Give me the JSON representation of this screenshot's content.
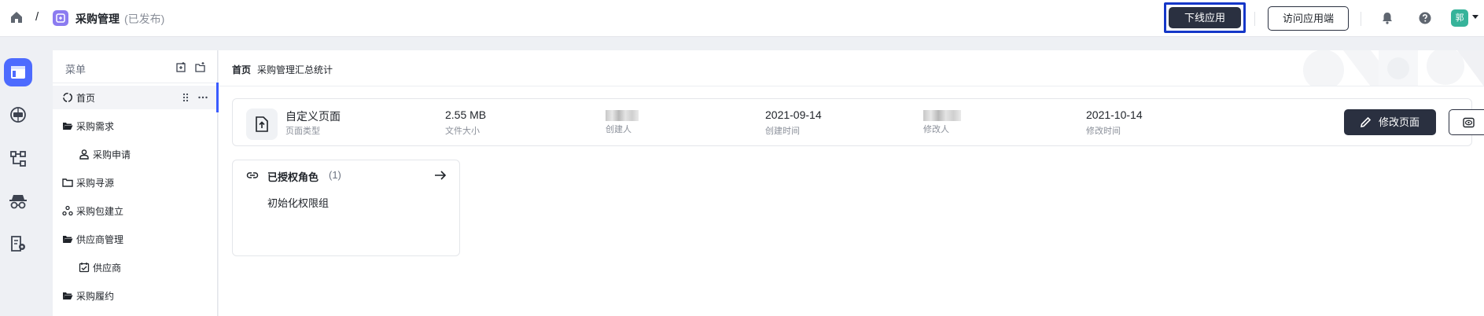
{
  "topbar": {
    "app_title": "采购管理",
    "app_status": "(已发布)",
    "offline_button": "下线应用",
    "visit_button": "访问应用端",
    "avatar_text": "郭"
  },
  "rail": {
    "items": [
      "page-icon",
      "globe-icon",
      "workflow-icon",
      "spy-icon",
      "doc-settings-icon"
    ]
  },
  "menu": {
    "title": "菜单",
    "items": [
      {
        "label": "首页",
        "icon": "home-circle-icon",
        "level": 0,
        "active": true
      },
      {
        "label": "采购需求",
        "icon": "folder-open-icon",
        "level": 0
      },
      {
        "label": "采购申请",
        "icon": "user-icon",
        "level": 1
      },
      {
        "label": "采购寻源",
        "icon": "folder-icon",
        "level": 0
      },
      {
        "label": "采购包建立",
        "icon": "nodes-icon",
        "level": 0
      },
      {
        "label": "供应商管理",
        "icon": "folder-open-icon",
        "level": 0
      },
      {
        "label": "供应商",
        "icon": "calendar-check-icon",
        "level": 1
      },
      {
        "label": "采购履约",
        "icon": "folder-open-icon",
        "level": 0
      }
    ]
  },
  "breadcrumb": {
    "home": "首页",
    "current": "采购管理汇总统计"
  },
  "info": {
    "page_type_value": "自定义页面",
    "page_type_label": "页面类型",
    "file_size_value": "2.55 MB",
    "file_size_label": "文件大小",
    "creator_label": "创建人",
    "created_time_value": "2021-09-14",
    "created_time_label": "创建时间",
    "modifier_label": "修改人",
    "modified_time_value": "2021-10-14",
    "modified_time_label": "修改时间",
    "edit_button": "修改页面",
    "preview_button": "预览"
  },
  "roles": {
    "title": "已授权角色",
    "count": "(1)",
    "items": [
      "初始化权限组"
    ]
  },
  "colors": {
    "accent": "#4d6bfe",
    "dark_button": "#2a3040",
    "highlight_outline": "#1537c8",
    "avatar_bg": "#36b39a",
    "app_icon_bg": "#8b7bf0"
  }
}
